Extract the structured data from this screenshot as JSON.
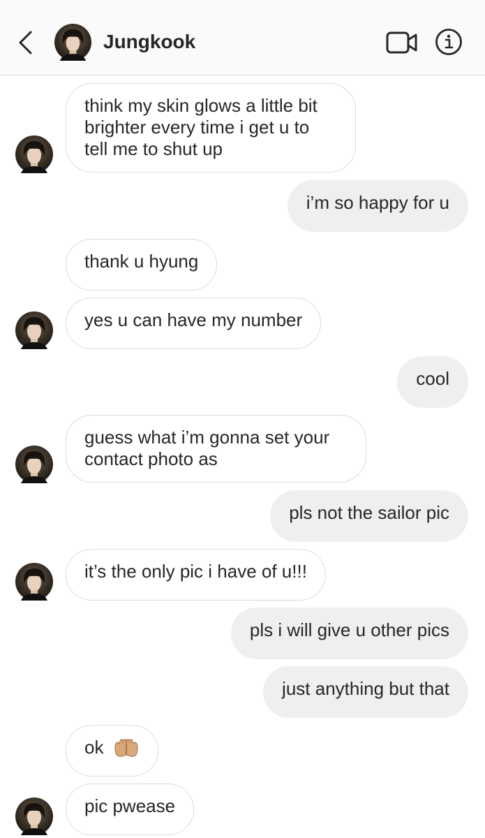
{
  "header": {
    "title": "Jungkook",
    "back_icon": "chevron-left-icon",
    "video_icon": "video-camera-icon",
    "info_icon": "info-icon"
  },
  "messages": [
    {
      "side": "in",
      "text": "think my skin glows a little bit\nbrighter every time i get u to\ntell me to shut up"
    },
    {
      "side": "out",
      "text": "i’m so happy for u"
    },
    {
      "side": "in",
      "text": "thank u hyung"
    },
    {
      "side": "in",
      "text": "yes u can have my number"
    },
    {
      "side": "out",
      "text": "cool"
    },
    {
      "side": "in",
      "text": "guess what i’m gonna set your\ncontact photo as"
    },
    {
      "side": "out",
      "text": "pls not the sailor pic"
    },
    {
      "side": "in",
      "text": "it’s the only pic i have of u!!!"
    },
    {
      "side": "out",
      "text": "pls i will give u other pics"
    },
    {
      "side": "out",
      "text": "just anything but that"
    },
    {
      "side": "in",
      "text": "ok",
      "emoji": "palms-up-together-emoji"
    },
    {
      "side": "in",
      "text": "pic pwease"
    }
  ],
  "colors": {
    "incoming_bubble": "#ffffff",
    "incoming_border": "#dbdbdb",
    "outgoing_bubble": "#efefef",
    "text": "#262626",
    "header_bg": "#fafafa"
  }
}
